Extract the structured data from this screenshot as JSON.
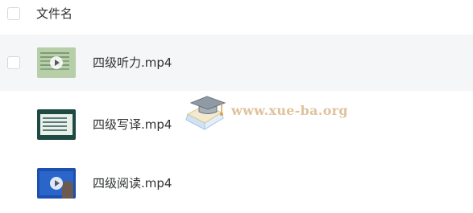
{
  "header": {
    "column_label": "文件名"
  },
  "files": [
    {
      "name": "四级听力.mp4",
      "type": "video",
      "hovered": true
    },
    {
      "name": "四级写译.mp4",
      "type": "video",
      "hovered": false
    },
    {
      "name": "四级阅读.mp4",
      "type": "video",
      "hovered": false
    }
  ],
  "watermark": {
    "text": "www.xue-ba.org",
    "icon": "graduation-cap-icon",
    "color": "#d9b98a"
  },
  "colors": {
    "hover_row": "#f5f6f7",
    "text": "#2f3133",
    "checkbox_border": "#d4d8de"
  }
}
